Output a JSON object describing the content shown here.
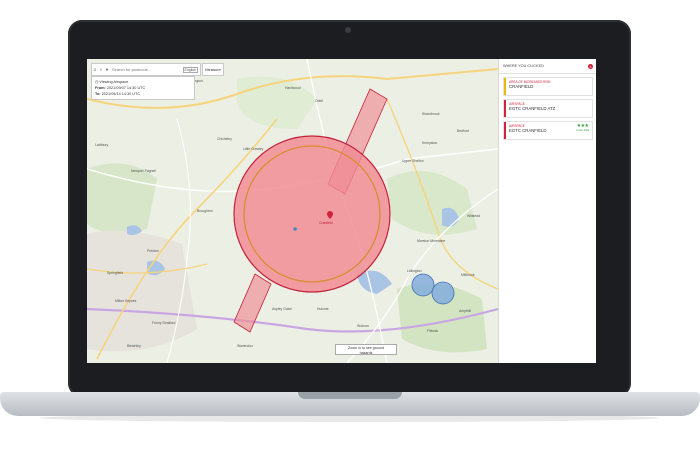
{
  "toolbar": {
    "search_placeholder": "Search for postcode...",
    "language": "English",
    "measure_label": "Measure"
  },
  "info": {
    "heading": "Viewing Airspace",
    "from_label": "From:",
    "from_value": "2021/09/07 14:30 UTC",
    "to_label": "To:",
    "to_value": "2021/09/14 14:30 UTC"
  },
  "map": {
    "zoom_hint_line1": "Zoom in to see ground",
    "zoom_hint_line2": "hazards",
    "places": {
      "thrapston": "Thrapston",
      "harrington": "Harrington",
      "hardwood": "Hardwood",
      "odell": "Odell",
      "sharnbrook": "Sharnbrook",
      "lathbury": "Lathbury",
      "chicheley": "Chicheley",
      "little_crawley": "Little Crawley",
      "cranfield": "Cranfield",
      "newport_pagnell": "Newport Pagnell",
      "woburn": "Woburn",
      "marston_moretaine": "Marston Moretaine",
      "kempston": "Kempston",
      "bedford": "Bedford",
      "great_barford": "Great Barford",
      "upper_shelton": "Upper Shelton",
      "ampthill": "Ampthill",
      "flitwick": "Flitwick",
      "lidlington": "Lidlington",
      "millbrook": "Millbrook",
      "aspley_guise": "Aspley Guise",
      "bletchley": "Bletchley",
      "wavendon": "Wavendon",
      "fenny_stratford": "Fenny Stratford",
      "milton_keynes": "Milton Keynes",
      "old_stratford": "Old Stratford",
      "springfield": "Springfield",
      "broughton": "Broughton",
      "woolstone": "Woolstone",
      "preston": "Preston",
      "hulcote": "Hulcote",
      "eversholt": "Eversholt",
      "steppingley": "Steppingley",
      "cardington": "Cardington",
      "wilstead": "Wilstead",
      "haynes": "Haynes",
      "bolnhurst": "Bolnhurst",
      "ravensden": "Ravensden"
    }
  },
  "panel": {
    "title": "WHERE YOU CLICKED",
    "cards": [
      {
        "category": "AREA OF INCREASED RISK",
        "name": "CRANFIELD",
        "color": "#f2b705"
      },
      {
        "category": "AIRSPACE",
        "name": "EGTC CRANFIELD ATZ",
        "color": "#d1213b"
      },
      {
        "category": "AIRSPACE",
        "name": "EGTC CRANFIELD",
        "color": "#d1213b",
        "rating_label": "Lower Risk"
      }
    ]
  },
  "colors": {
    "zone_fill": "#f08a93",
    "zone_stroke": "#c4213a",
    "atz_ring": "#d98c2a",
    "accent": "#d1213b"
  }
}
